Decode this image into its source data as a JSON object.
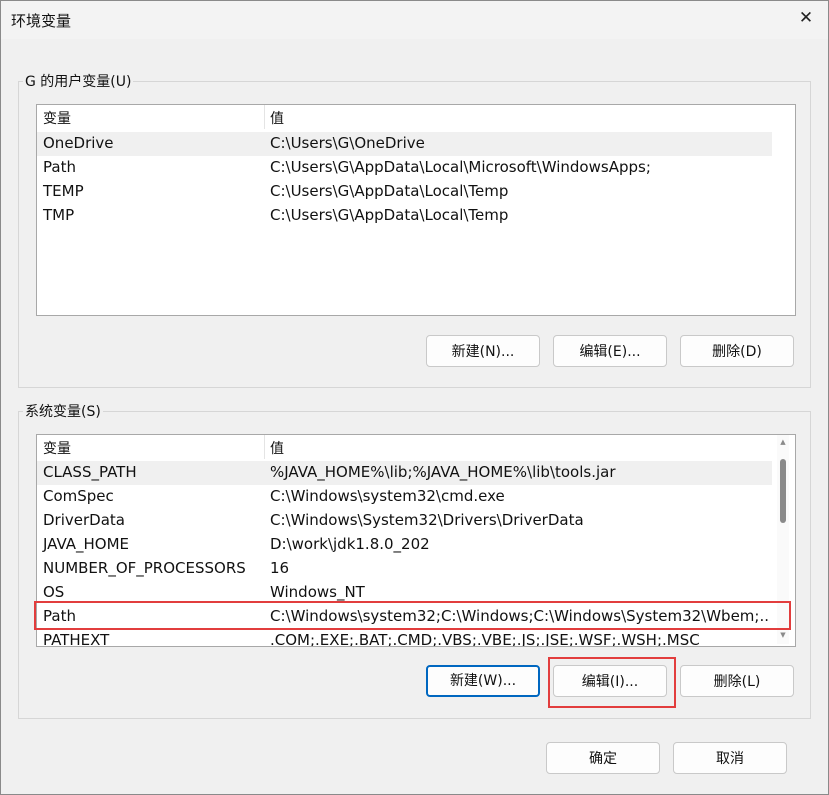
{
  "window": {
    "title": "环境变量",
    "close_glyph": "✕"
  },
  "user_vars": {
    "group_title": "G 的用户变量(U)",
    "headers": {
      "name": "变量",
      "value": "值"
    },
    "rows": [
      {
        "name": "OneDrive",
        "value": "C:\\Users\\G\\OneDrive"
      },
      {
        "name": "Path",
        "value": "C:\\Users\\G\\AppData\\Local\\Microsoft\\WindowsApps;"
      },
      {
        "name": "TEMP",
        "value": "C:\\Users\\G\\AppData\\Local\\Temp"
      },
      {
        "name": "TMP",
        "value": "C:\\Users\\G\\AppData\\Local\\Temp"
      }
    ],
    "buttons": {
      "new": "新建(N)...",
      "edit": "编辑(E)...",
      "delete": "删除(D)"
    }
  },
  "system_vars": {
    "group_title": "系统变量(S)",
    "headers": {
      "name": "变量",
      "value": "值"
    },
    "rows": [
      {
        "name": "CLASS_PATH",
        "value": "%JAVA_HOME%\\lib;%JAVA_HOME%\\lib\\tools.jar"
      },
      {
        "name": "ComSpec",
        "value": "C:\\Windows\\system32\\cmd.exe"
      },
      {
        "name": "DriverData",
        "value": "C:\\Windows\\System32\\Drivers\\DriverData"
      },
      {
        "name": "JAVA_HOME",
        "value": "D:\\work\\jdk1.8.0_202"
      },
      {
        "name": "NUMBER_OF_PROCESSORS",
        "value": "16"
      },
      {
        "name": "OS",
        "value": "Windows_NT"
      },
      {
        "name": "Path",
        "value": "C:\\Windows\\system32;C:\\Windows;C:\\Windows\\System32\\Wbem;..."
      },
      {
        "name": "PATHEXT",
        "value": ".COM;.EXE;.BAT;.CMD;.VBS;.VBE;.JS;.JSE;.WSF;.WSH;.MSC"
      }
    ],
    "buttons": {
      "new": "新建(W)...",
      "edit": "编辑(I)...",
      "delete": "删除(L)"
    }
  },
  "footer": {
    "ok": "确定",
    "cancel": "取消"
  },
  "colors": {
    "highlight": "#e23d3d",
    "accent": "#0067c0"
  }
}
